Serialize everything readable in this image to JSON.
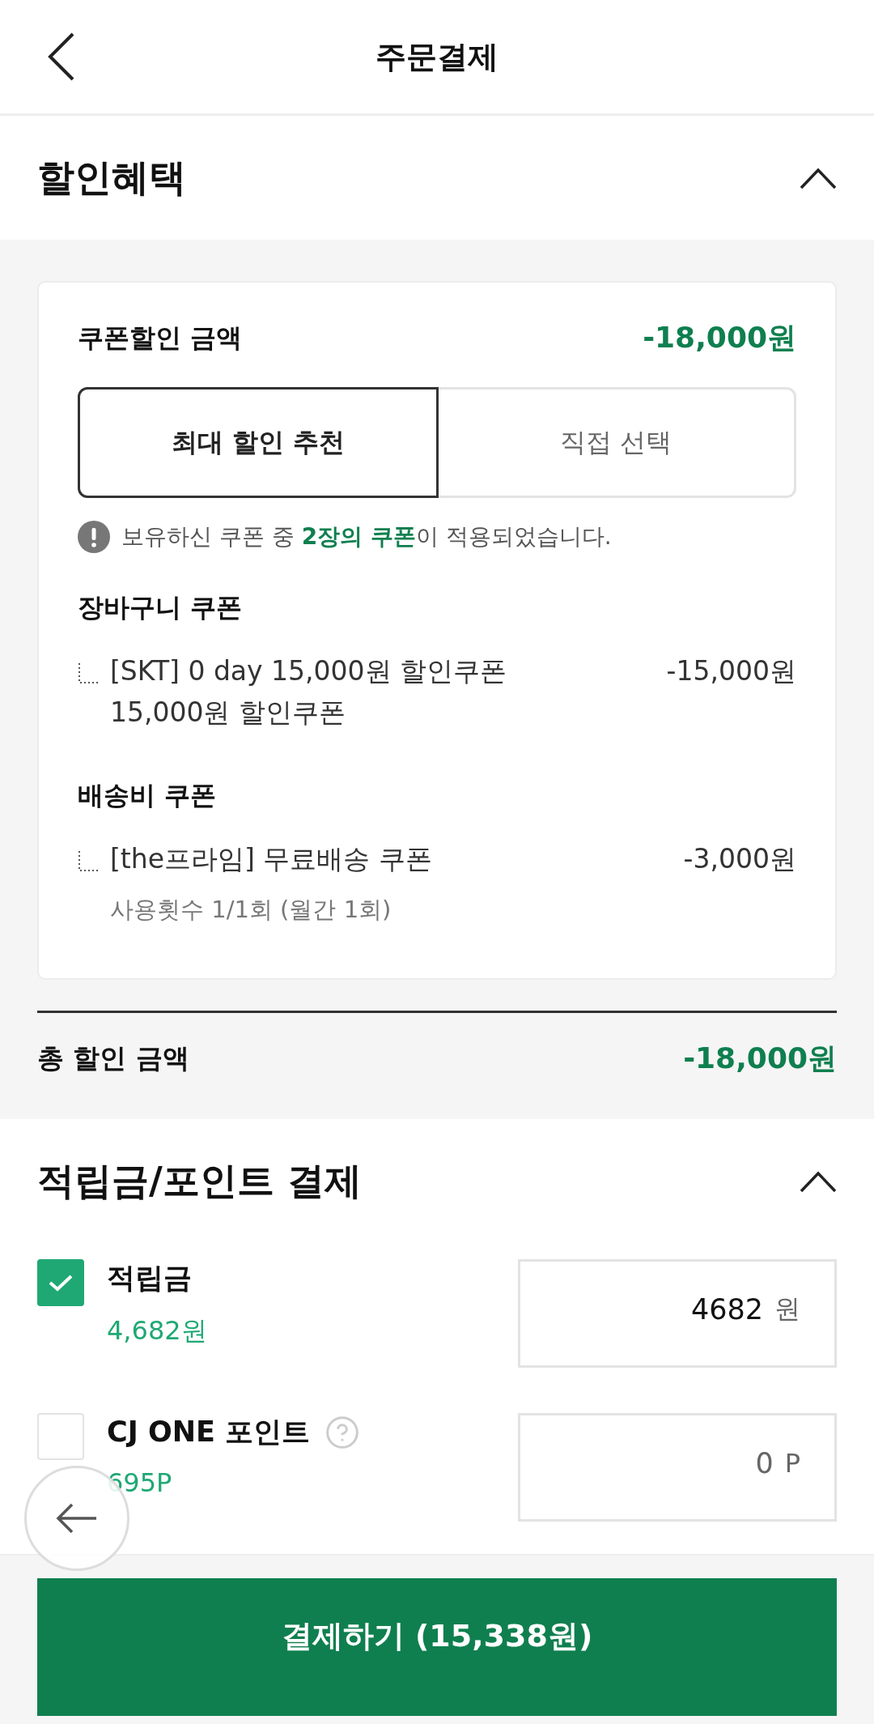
{
  "header": {
    "title": "주문결제"
  },
  "discount": {
    "title": "할인혜택",
    "expanded": true,
    "coupon_label": "쿠폰할인 금액",
    "coupon_amount": "-18,000원",
    "tabs": [
      {
        "label": "최대 할인 추천",
        "selected": true
      },
      {
        "label": "직접 선택",
        "selected": false
      }
    ],
    "notice": "보유하신 쿠폰 중 **2장의 쿠폰**이 적용되었습니다.",
    "groups": [
      {
        "title": "장바구니 쿠폰",
        "items": [
          {
            "name": "[SKT] 0 day 15,000원 할인쿠폰 15,000원 할인쿠폰",
            "amount": "-15,000원"
          }
        ]
      },
      {
        "title": "배송비 쿠폰",
        "items": [
          {
            "name": "[the프라임] 무료배송 쿠폰",
            "amount": "-3,000원",
            "note": "사용횟수 1/1회 (월간 1회)"
          }
        ]
      }
    ],
    "total_label": "총 할인 금액",
    "total_amount": "-18,000원"
  },
  "points": {
    "title": "적립금/포인트 결제",
    "expanded": true,
    "rows": [
      {
        "label": "적립금",
        "balance": "4,682원",
        "checked": true,
        "value": "4682",
        "unit": "원",
        "help": false
      },
      {
        "label": "CJ ONE 포인트",
        "balance": "695P",
        "checked": false,
        "value": "0",
        "unit": "P",
        "help": true
      }
    ]
  },
  "pay_button": "결제하기 (15,338원)"
}
